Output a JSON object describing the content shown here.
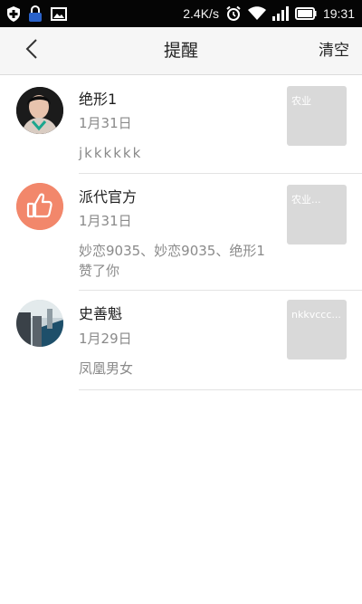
{
  "status_bar": {
    "net_speed": "2.4K/s",
    "time": "19:31",
    "icons": [
      "shield-icon",
      "lock-icon",
      "image-icon",
      "alarm-icon",
      "wifi-icon",
      "signal-icon",
      "battery-icon"
    ]
  },
  "header": {
    "back_icon": "chevron-left-icon",
    "title": "提醒",
    "clear_label": "清空"
  },
  "notifications": [
    {
      "name": "绝形1",
      "date": "1月31日",
      "content": "jkkkkkk",
      "thumb_text": "农业",
      "avatar": "user-photo"
    },
    {
      "name": "派代官方",
      "date": "1月31日",
      "content": "妙恋9035、妙恋9035、绝形1 赞了你",
      "thumb_text": "农业...",
      "avatar": "thumbs-up-icon",
      "avatar_color": "#f2876b"
    },
    {
      "name": "史善魁",
      "date": "1月29日",
      "content": "凤凰男女",
      "thumb_text": "nkkvccc...",
      "avatar": "user-photo"
    }
  ],
  "colors": {
    "status_bar": "#050505",
    "header_bg": "#f6f6f6",
    "thumb_bg": "#d9d9d9",
    "muted_text": "#8a8a8a"
  }
}
